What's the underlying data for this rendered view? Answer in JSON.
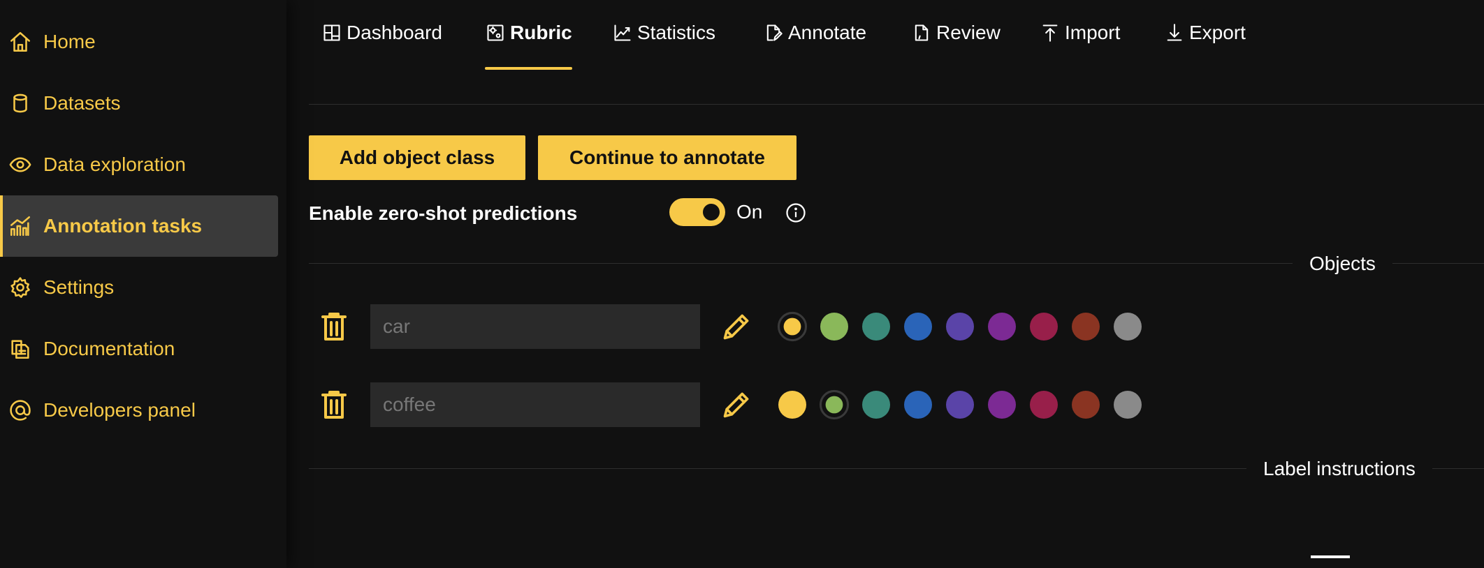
{
  "sidebar": {
    "items": [
      {
        "label": "Home",
        "icon": "home-icon",
        "active": false
      },
      {
        "label": "Datasets",
        "icon": "database-icon",
        "active": false
      },
      {
        "label": "Data exploration",
        "icon": "eye-icon",
        "active": false
      },
      {
        "label": "Annotation tasks",
        "icon": "chart-icon",
        "active": true
      },
      {
        "label": "Settings",
        "icon": "gear-icon",
        "active": false
      },
      {
        "label": "Documentation",
        "icon": "documents-icon",
        "active": false
      },
      {
        "label": "Developers panel",
        "icon": "at-icon",
        "active": false
      }
    ]
  },
  "tabs": [
    {
      "label": "Dashboard",
      "icon": "dashboard-icon",
      "active": false
    },
    {
      "label": "Rubric",
      "icon": "rubric-icon",
      "active": true
    },
    {
      "label": "Statistics",
      "icon": "line-chart-icon",
      "active": false
    },
    {
      "label": "Annotate",
      "icon": "annotate-icon",
      "active": false
    },
    {
      "label": "Review",
      "icon": "review-icon",
      "active": false
    },
    {
      "label": "Import",
      "icon": "upload-icon",
      "active": false
    },
    {
      "label": "Export",
      "icon": "download-icon",
      "active": false
    }
  ],
  "actions": {
    "add_object_class": "Add object class",
    "continue_to_annotate": "Continue to annotate"
  },
  "zero_shot": {
    "label": "Enable zero-shot predictions",
    "state": "On",
    "enabled": true
  },
  "sections": {
    "objects": "Objects",
    "label_instructions": "Label instructions"
  },
  "palette": [
    "#f7c948",
    "#8ab85a",
    "#3a8a7a",
    "#2a64b8",
    "#5a44a8",
    "#7c2a94",
    "#981f4a",
    "#8a3422",
    "#8a8a8a"
  ],
  "objects": [
    {
      "placeholder": "car",
      "selected_color": 0
    },
    {
      "placeholder": "coffee",
      "selected_color": 1
    }
  ],
  "colors": {
    "accent": "#f7c948",
    "background": "#111111",
    "active_nav_bg": "#3a3a3a",
    "input_bg": "#2a2a2a"
  }
}
